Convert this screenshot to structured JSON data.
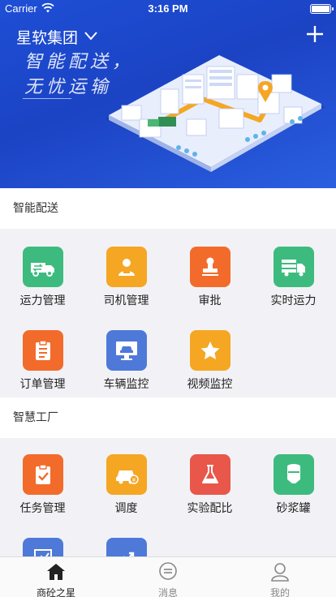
{
  "status_bar": {
    "carrier": "Carrier",
    "time": "3:16 PM"
  },
  "header": {
    "company": "星软集团",
    "slogan_line1": "智能配送，",
    "slogan_line2": "无忧运输"
  },
  "sections": [
    {
      "title": "智能配送",
      "items": [
        {
          "label": "运力管理",
          "color": "#3dbb7f",
          "icon": "truck-swap-icon"
        },
        {
          "label": "司机管理",
          "color": "#f5a623",
          "icon": "driver-icon"
        },
        {
          "label": "审批",
          "color": "#f26b2b",
          "icon": "stamp-icon"
        },
        {
          "label": "实时运力",
          "color": "#3dbb7f",
          "icon": "truck-cargo-icon"
        },
        {
          "label": "订单管理",
          "color": "#f26b2b",
          "icon": "clipboard-icon"
        },
        {
          "label": "车辆监控",
          "color": "#4f79d8",
          "icon": "car-monitor-icon"
        },
        {
          "label": "视频监控",
          "color": "#f5a623",
          "icon": "star-icon"
        }
      ]
    },
    {
      "title": "智慧工厂",
      "items": [
        {
          "label": "任务管理",
          "color": "#f26b2b",
          "icon": "task-check-icon"
        },
        {
          "label": "调度",
          "color": "#f5a623",
          "icon": "car-dispatch-icon"
        },
        {
          "label": "实验配比",
          "color": "#e8574a",
          "icon": "flask-icon"
        },
        {
          "label": "砂浆罐",
          "color": "#3dbb7f",
          "icon": "tank-icon"
        },
        {
          "label": "",
          "color": "#4f79d8",
          "icon": "chart-icon"
        },
        {
          "label": "",
          "color": "#4f79d8",
          "icon": "trend-icon"
        }
      ]
    }
  ],
  "tabbar": [
    {
      "label": "商砼之星",
      "icon": "home-icon",
      "active": true
    },
    {
      "label": "消息",
      "icon": "message-icon",
      "active": false
    },
    {
      "label": "我的",
      "icon": "profile-icon",
      "active": false
    }
  ]
}
